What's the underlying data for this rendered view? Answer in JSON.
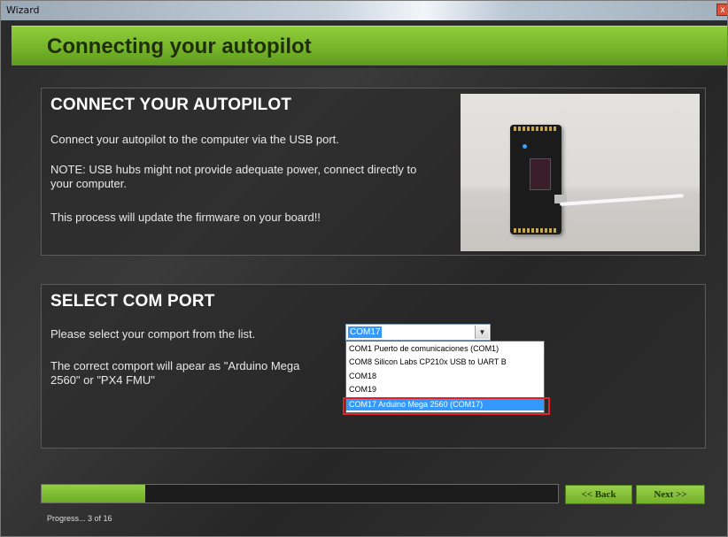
{
  "window": {
    "title": "Wizard",
    "close_label": "x"
  },
  "banner": {
    "title": "Connecting your autopilot"
  },
  "connect_panel": {
    "heading": "CONNECT YOUR AUTOPILOT",
    "line1": "Connect your autopilot to the computer via the USB port.",
    "note": "NOTE: USB hubs might not provide adequate power, connect directly to your computer.",
    "warning": "This process will update the firmware on your board!!"
  },
  "com_panel": {
    "heading": "SELECT COM PORT",
    "instruction": "Please select your comport from the list.",
    "hint": "The correct comport will apear as \"Arduino Mega 2560\" or \"PX4 FMU\"",
    "selected": "COM17",
    "options": [
      "COM1 Puerto de comunicaciones (COM1)",
      "COM8 Silicon Labs CP210x USB to UART B",
      "COM18",
      "COM19",
      "COM17 Arduino Mega 2560 (COM17)"
    ],
    "highlighted_option_index": 4
  },
  "progress": {
    "value": 0.2,
    "text": "Progress... 3 of 16"
  },
  "buttons": {
    "back": "<< Back",
    "next": "Next >>"
  },
  "colors": {
    "accent_green": "#76b52a",
    "highlight_red": "#e0232b",
    "selection_blue": "#3399ff"
  }
}
